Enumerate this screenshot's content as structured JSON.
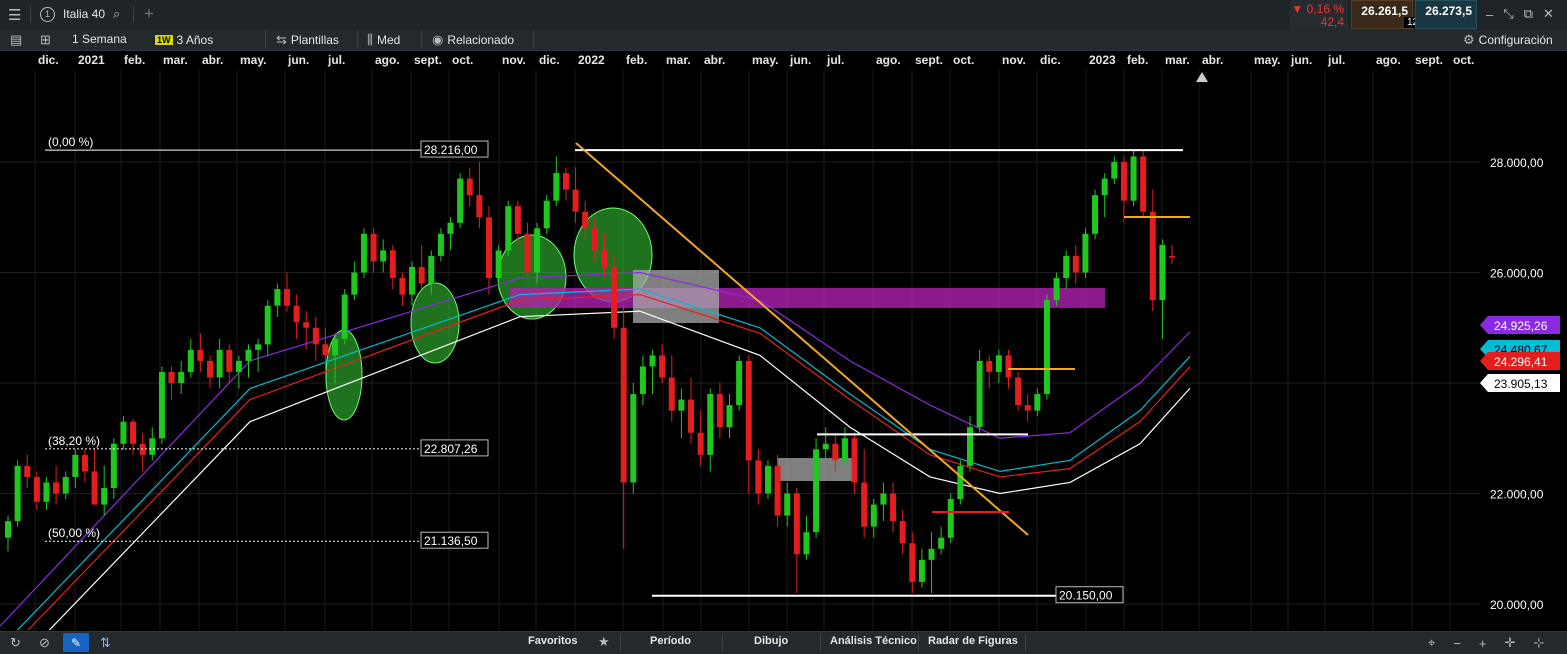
{
  "topbar": {
    "instrument": "Italia 40",
    "change_pct": "▼ 0,16 %",
    "change_abs": "42,4",
    "bid": "26.261,5",
    "spread": "12,0",
    "ask": "26.273,5"
  },
  "toolbar": {
    "interval": "1 Semana",
    "interval_badge": "1W",
    "range": "3 Años",
    "templates": "Plantillas",
    "indicator": "Med",
    "related": "Relacionado",
    "settings": "Configuración"
  },
  "months": [
    "dic.",
    "2021",
    "feb.",
    "mar.",
    "abr.",
    "may.",
    "jun.",
    "jul.",
    "ago.",
    "sept.",
    "oct.",
    "nov.",
    "dic.",
    "2022",
    "feb.",
    "mar.",
    "abr.",
    "may.",
    "jun.",
    "jul.",
    "ago.",
    "sept.",
    "oct.",
    "nov.",
    "dic.",
    "2023",
    "feb.",
    "mar.",
    "abr.",
    "may.",
    "jun.",
    "jul.",
    "ago.",
    "sept.",
    "oct."
  ],
  "bottombar": {
    "favorites": "Favoritos",
    "period": "Período",
    "drawing": "Dibujo",
    "technical": "Análisis Técnico",
    "radar": "Radar de Figuras"
  },
  "chart_data": {
    "type": "candlestick",
    "instrument": "Italia 40",
    "interval": "1 Semana",
    "ylim": [
      19500,
      29300
    ],
    "y_ticks": [
      20000,
      22000,
      24000,
      26000,
      28000
    ],
    "y_tick_labels": [
      "20.000,00",
      "22.000,00",
      "24.000,00",
      "26.000,00",
      "28.000,00"
    ],
    "fibonacci": [
      {
        "label": "(0,00 %)",
        "value_label": "28.216,00",
        "value": 28216
      },
      {
        "label": "(38,20 %)",
        "value_label": "22.807,26",
        "value": 22807.26
      },
      {
        "label": "(50,00 %)",
        "value_label": "21.136,50",
        "value": 21136.5
      }
    ],
    "horizontal_levels": [
      {
        "value": 20150,
        "label": "20.150,00"
      },
      {
        "value": 23070,
        "label": ""
      },
      {
        "value": 28216,
        "label": ""
      }
    ],
    "price_labels": [
      {
        "value": 24925.26,
        "label": "24.925,26",
        "color": "#8a2be2"
      },
      {
        "value": 24480.67,
        "label": "24.480,67",
        "color": "#00bcd4"
      },
      {
        "value": 24296.41,
        "label": "24.296,41",
        "color": "#e41e1e"
      },
      {
        "value": 23905.13,
        "label": "23.905,13",
        "color": "#ffffff"
      }
    ],
    "colors": {
      "up": "#1ec81e",
      "down": "#e41e1e",
      "trendline": "#f5a623",
      "zone": "#b020b0",
      "box": "#9a9a9a",
      "highlight": "#39d139"
    },
    "candles": [
      [
        21200,
        21600,
        20950,
        21500
      ],
      [
        21500,
        22600,
        21400,
        22500
      ],
      [
        22500,
        22700,
        22100,
        22300
      ],
      [
        22300,
        22400,
        21700,
        21850
      ],
      [
        21850,
        22300,
        21700,
        22200
      ],
      [
        22200,
        22500,
        21800,
        22000
      ],
      [
        22000,
        22400,
        21900,
        22300
      ],
      [
        22300,
        22800,
        22100,
        22700
      ],
      [
        22700,
        22800,
        22200,
        22400
      ],
      [
        22400,
        22800,
        22000,
        21800
      ],
      [
        21800,
        22500,
        21600,
        22100
      ],
      [
        22100,
        23000,
        21900,
        22900
      ],
      [
        22900,
        23400,
        22800,
        23300
      ],
      [
        23300,
        23350,
        22700,
        22900
      ],
      [
        22900,
        23100,
        22400,
        22700
      ],
      [
        22700,
        23200,
        22600,
        23000
      ],
      [
        23000,
        24300,
        22900,
        24200
      ],
      [
        24200,
        24300,
        23700,
        24000
      ],
      [
        24000,
        24400,
        23800,
        24200
      ],
      [
        24200,
        24800,
        24100,
        24600
      ],
      [
        24600,
        24900,
        24200,
        24400
      ],
      [
        24400,
        24500,
        23900,
        24100
      ],
      [
        24100,
        24800,
        23900,
        24600
      ],
      [
        24600,
        24700,
        24000,
        24200
      ],
      [
        24200,
        24500,
        23900,
        24400
      ],
      [
        24400,
        24700,
        24100,
        24600
      ],
      [
        24600,
        24800,
        24200,
        24700
      ],
      [
        24700,
        25500,
        24500,
        25400
      ],
      [
        25400,
        25800,
        25200,
        25700
      ],
      [
        25700,
        26000,
        25300,
        25400
      ],
      [
        25400,
        25600,
        24800,
        25100
      ],
      [
        25100,
        25300,
        24600,
        25000
      ],
      [
        25000,
        25200,
        24400,
        24700
      ],
      [
        24700,
        25000,
        24200,
        24500
      ],
      [
        24500,
        24900,
        24000,
        24800
      ],
      [
        24800,
        25700,
        24700,
        25600
      ],
      [
        25600,
        26200,
        25500,
        26000
      ],
      [
        26000,
        26800,
        25900,
        26700
      ],
      [
        26700,
        26800,
        26000,
        26200
      ],
      [
        26200,
        26600,
        26000,
        26400
      ],
      [
        26400,
        26500,
        25700,
        25900
      ],
      [
        25900,
        26000,
        25400,
        25600
      ],
      [
        25600,
        26200,
        25400,
        26100
      ],
      [
        26100,
        26500,
        25700,
        25800
      ],
      [
        25800,
        26400,
        25600,
        26300
      ],
      [
        26300,
        26800,
        26200,
        26700
      ],
      [
        26700,
        27000,
        26400,
        26900
      ],
      [
        26900,
        27800,
        26800,
        27700
      ],
      [
        27700,
        27900,
        27200,
        27400
      ],
      [
        27400,
        28000,
        26800,
        27000
      ],
      [
        27000,
        27200,
        25600,
        25900
      ],
      [
        25900,
        26500,
        25700,
        26400
      ],
      [
        26400,
        27300,
        26300,
        27200
      ],
      [
        27200,
        27300,
        26500,
        26700
      ],
      [
        26700,
        26900,
        25800,
        26000
      ],
      [
        26000,
        26900,
        25800,
        26800
      ],
      [
        26800,
        27400,
        26700,
        27300
      ],
      [
        27300,
        28100,
        27200,
        27800
      ],
      [
        27800,
        27900,
        27300,
        27500
      ],
      [
        27500,
        27900,
        26900,
        27100
      ],
      [
        27100,
        27300,
        26600,
        26800
      ],
      [
        26800,
        27000,
        26200,
        26400
      ],
      [
        26400,
        26700,
        25900,
        26100
      ],
      [
        26100,
        26300,
        24800,
        25000
      ],
      [
        25000,
        25400,
        21000,
        22200
      ],
      [
        22200,
        24000,
        22000,
        23800
      ],
      [
        23800,
        24500,
        23600,
        24300
      ],
      [
        24300,
        24600,
        23800,
        24500
      ],
      [
        24500,
        24700,
        24000,
        24100
      ],
      [
        24100,
        24500,
        23300,
        23500
      ],
      [
        23500,
        23900,
        23000,
        23700
      ],
      [
        23700,
        24100,
        22900,
        23100
      ],
      [
        23100,
        23500,
        22500,
        22700
      ],
      [
        22700,
        23900,
        22400,
        23800
      ],
      [
        23800,
        24000,
        23000,
        23200
      ],
      [
        23200,
        23800,
        23000,
        23600
      ],
      [
        23600,
        24500,
        23500,
        24400
      ],
      [
        24400,
        24500,
        22000,
        22600
      ],
      [
        22600,
        22800,
        21800,
        22000
      ],
      [
        22000,
        22600,
        21900,
        22500
      ],
      [
        22500,
        22700,
        21400,
        21600
      ],
      [
        21600,
        22200,
        21400,
        22000
      ],
      [
        22000,
        22100,
        20200,
        20900
      ],
      [
        20900,
        21600,
        20800,
        21300
      ],
      [
        21300,
        23000,
        21200,
        22800
      ],
      [
        22800,
        23200,
        22600,
        22900
      ],
      [
        22900,
        23100,
        22400,
        22600
      ],
      [
        22600,
        23200,
        22500,
        23000
      ],
      [
        23000,
        23100,
        22000,
        22200
      ],
      [
        22200,
        22800,
        21200,
        21400
      ],
      [
        21400,
        21900,
        21200,
        21800
      ],
      [
        21800,
        22200,
        21500,
        22000
      ],
      [
        22000,
        22200,
        21300,
        21500
      ],
      [
        21500,
        21700,
        20900,
        21100
      ],
      [
        21100,
        21300,
        20200,
        20400
      ],
      [
        20400,
        21000,
        20300,
        20800
      ],
      [
        20800,
        21300,
        20200,
        21000
      ],
      [
        21000,
        21400,
        20900,
        21200
      ],
      [
        21200,
        22000,
        21100,
        21900
      ],
      [
        21900,
        22600,
        21800,
        22500
      ],
      [
        22500,
        23400,
        22400,
        23200
      ],
      [
        23200,
        24600,
        23100,
        24400
      ],
      [
        24400,
        24500,
        23900,
        24200
      ],
      [
        24200,
        24600,
        24000,
        24500
      ],
      [
        24500,
        24600,
        23900,
        24100
      ],
      [
        24100,
        24200,
        23500,
        23600
      ],
      [
        23600,
        23800,
        23300,
        23500
      ],
      [
        23500,
        23900,
        23400,
        23800
      ],
      [
        23800,
        25600,
        23700,
        25500
      ],
      [
        25500,
        26000,
        25400,
        25900
      ],
      [
        25900,
        26400,
        25700,
        26300
      ],
      [
        26300,
        26500,
        25800,
        26000
      ],
      [
        26000,
        26800,
        25900,
        26700
      ],
      [
        26700,
        27500,
        26600,
        27400
      ],
      [
        27400,
        27800,
        27000,
        27700
      ],
      [
        27700,
        28100,
        27600,
        28000
      ],
      [
        28000,
        28100,
        26900,
        27300
      ],
      [
        27300,
        28200,
        27200,
        28100
      ],
      [
        28100,
        28200,
        27000,
        27100
      ],
      [
        27100,
        27500,
        25300,
        25500
      ],
      [
        25500,
        26600,
        24800,
        26500
      ],
      [
        26300,
        26500,
        26150,
        26270
      ]
    ],
    "moving_averages": [
      {
        "name": "",
        "color": "#8a2be2",
        "values": [
          19600,
          24400,
          25900,
          26000,
          25500,
          24400,
          23600,
          23000,
          23100,
          24000,
          24925.26
        ]
      },
      {
        "name": "",
        "color": "#00bcd4",
        "values": [
          19200,
          23900,
          25600,
          25700,
          25000,
          23800,
          22800,
          22400,
          22600,
          23500,
          24480.67
        ]
      },
      {
        "name": "",
        "color": "#e41e1e",
        "values": [
          19000,
          23700,
          25500,
          25600,
          24900,
          23700,
          22700,
          22300,
          22450,
          23300,
          24296.41
        ]
      },
      {
        "name": "",
        "color": "#ffffff",
        "values": [
          18600,
          23300,
          25200,
          25300,
          24500,
          23200,
          22300,
          22000,
          22200,
          22900,
          23905.13
        ]
      }
    ]
  }
}
